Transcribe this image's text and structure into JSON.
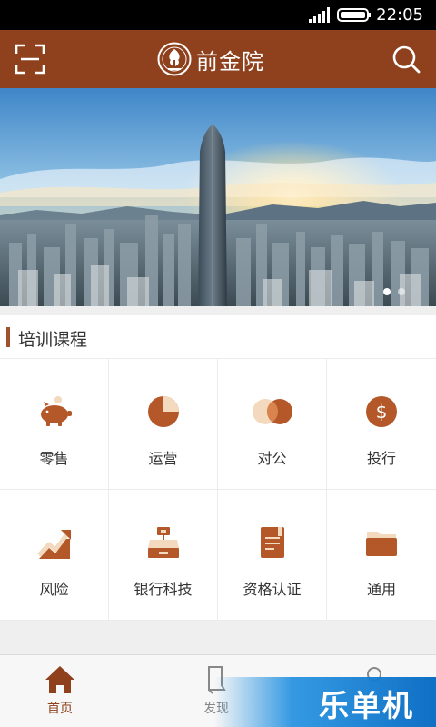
{
  "status_bar": {
    "time": "22:05"
  },
  "header": {
    "title": "前金院"
  },
  "banner": {
    "slide_count": 2,
    "active_slide": 1
  },
  "section": {
    "title": "培训课程",
    "items": [
      {
        "label": "零售",
        "icon": "piggy-bank-icon"
      },
      {
        "label": "运营",
        "icon": "pie-chart-icon"
      },
      {
        "label": "对公",
        "icon": "circles-icon"
      },
      {
        "label": "投行",
        "icon": "dollar-coin-icon"
      },
      {
        "label": "风险",
        "icon": "trend-chart-icon"
      },
      {
        "label": "银行科技",
        "icon": "cash-register-icon"
      },
      {
        "label": "资格认证",
        "icon": "certificate-book-icon"
      },
      {
        "label": "通用",
        "icon": "folder-icon"
      }
    ]
  },
  "tabbar": {
    "items": [
      {
        "label": "首页",
        "icon": "home-icon",
        "active": true
      },
      {
        "label": "发现",
        "icon": "bookmark-icon",
        "active": false
      },
      {
        "label": "",
        "icon": "person-icon",
        "active": false
      }
    ]
  },
  "watermark": {
    "text": "乐单机"
  },
  "colors": {
    "brand": "#8e411c",
    "accent": "#b4582a",
    "accent_light": "#f3d9bd"
  }
}
